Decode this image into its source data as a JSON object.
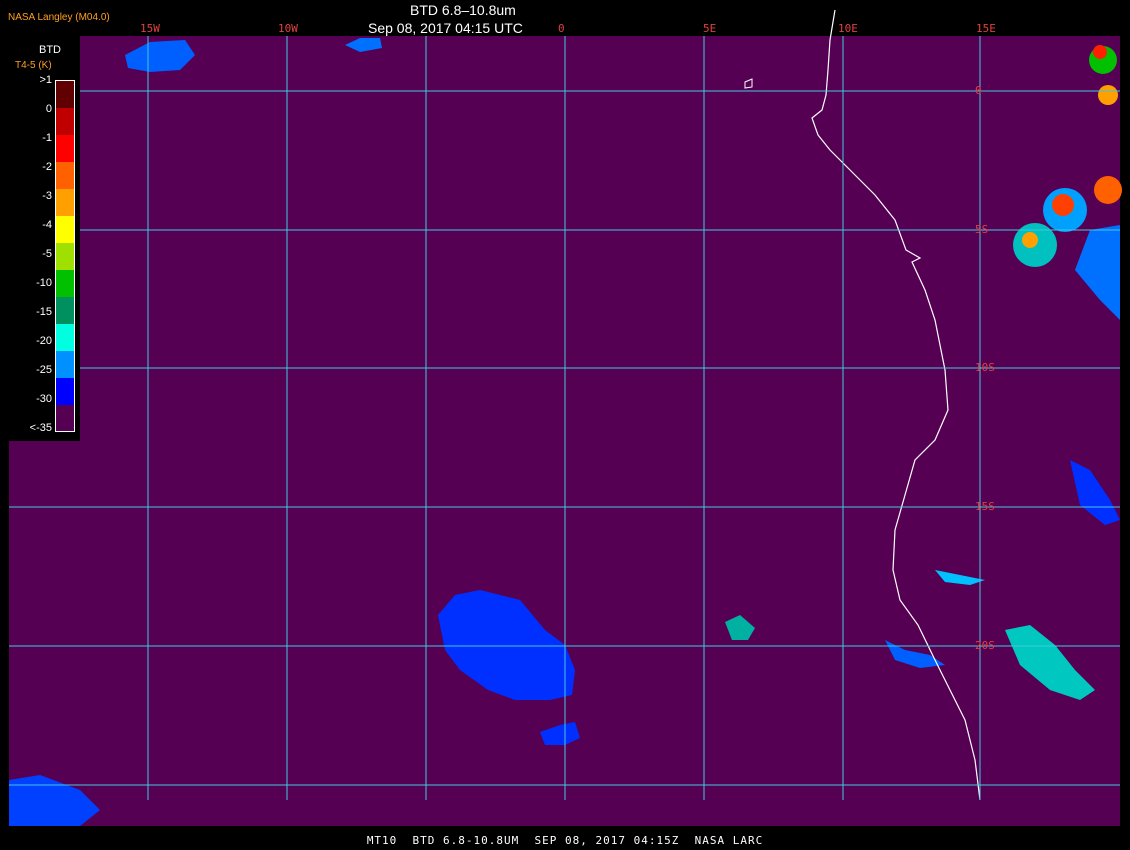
{
  "header": {
    "agency": "NASA Langley (M04.0)",
    "product": "BTD 6.8–10.8um",
    "datetime": "Sep 08, 2017 04:15 UTC"
  },
  "footer": {
    "text": "MT10  BTD 6.8-10.8UM  SEP 08, 2017 04:15Z  NASA LARC"
  },
  "map": {
    "background_color": "#560054",
    "grid_color": "#40c8e0",
    "coastline_color": "#ffffff",
    "longitude_labels": [
      "15W",
      "10W",
      "0",
      "5E",
      "10E",
      "15E"
    ],
    "latitude_labels": [
      "0",
      "5S",
      "10S",
      "15S",
      "20S"
    ]
  },
  "legend": {
    "title": "BTD",
    "subtitle": "T4-5 (K)",
    "ticks": [
      ">1",
      "0",
      "-1",
      "-2",
      "-3",
      "-4",
      "-5",
      "-10",
      "-15",
      "-20",
      "-25",
      "-30",
      "<-35"
    ],
    "colors": [
      "#600000",
      "#c00000",
      "#ff0000",
      "#ff6000",
      "#ffa000",
      "#ffff00",
      "#a0e000",
      "#00c000",
      "#009060",
      "#00ffe0",
      "#0090ff",
      "#0000ff",
      "#560054"
    ]
  }
}
